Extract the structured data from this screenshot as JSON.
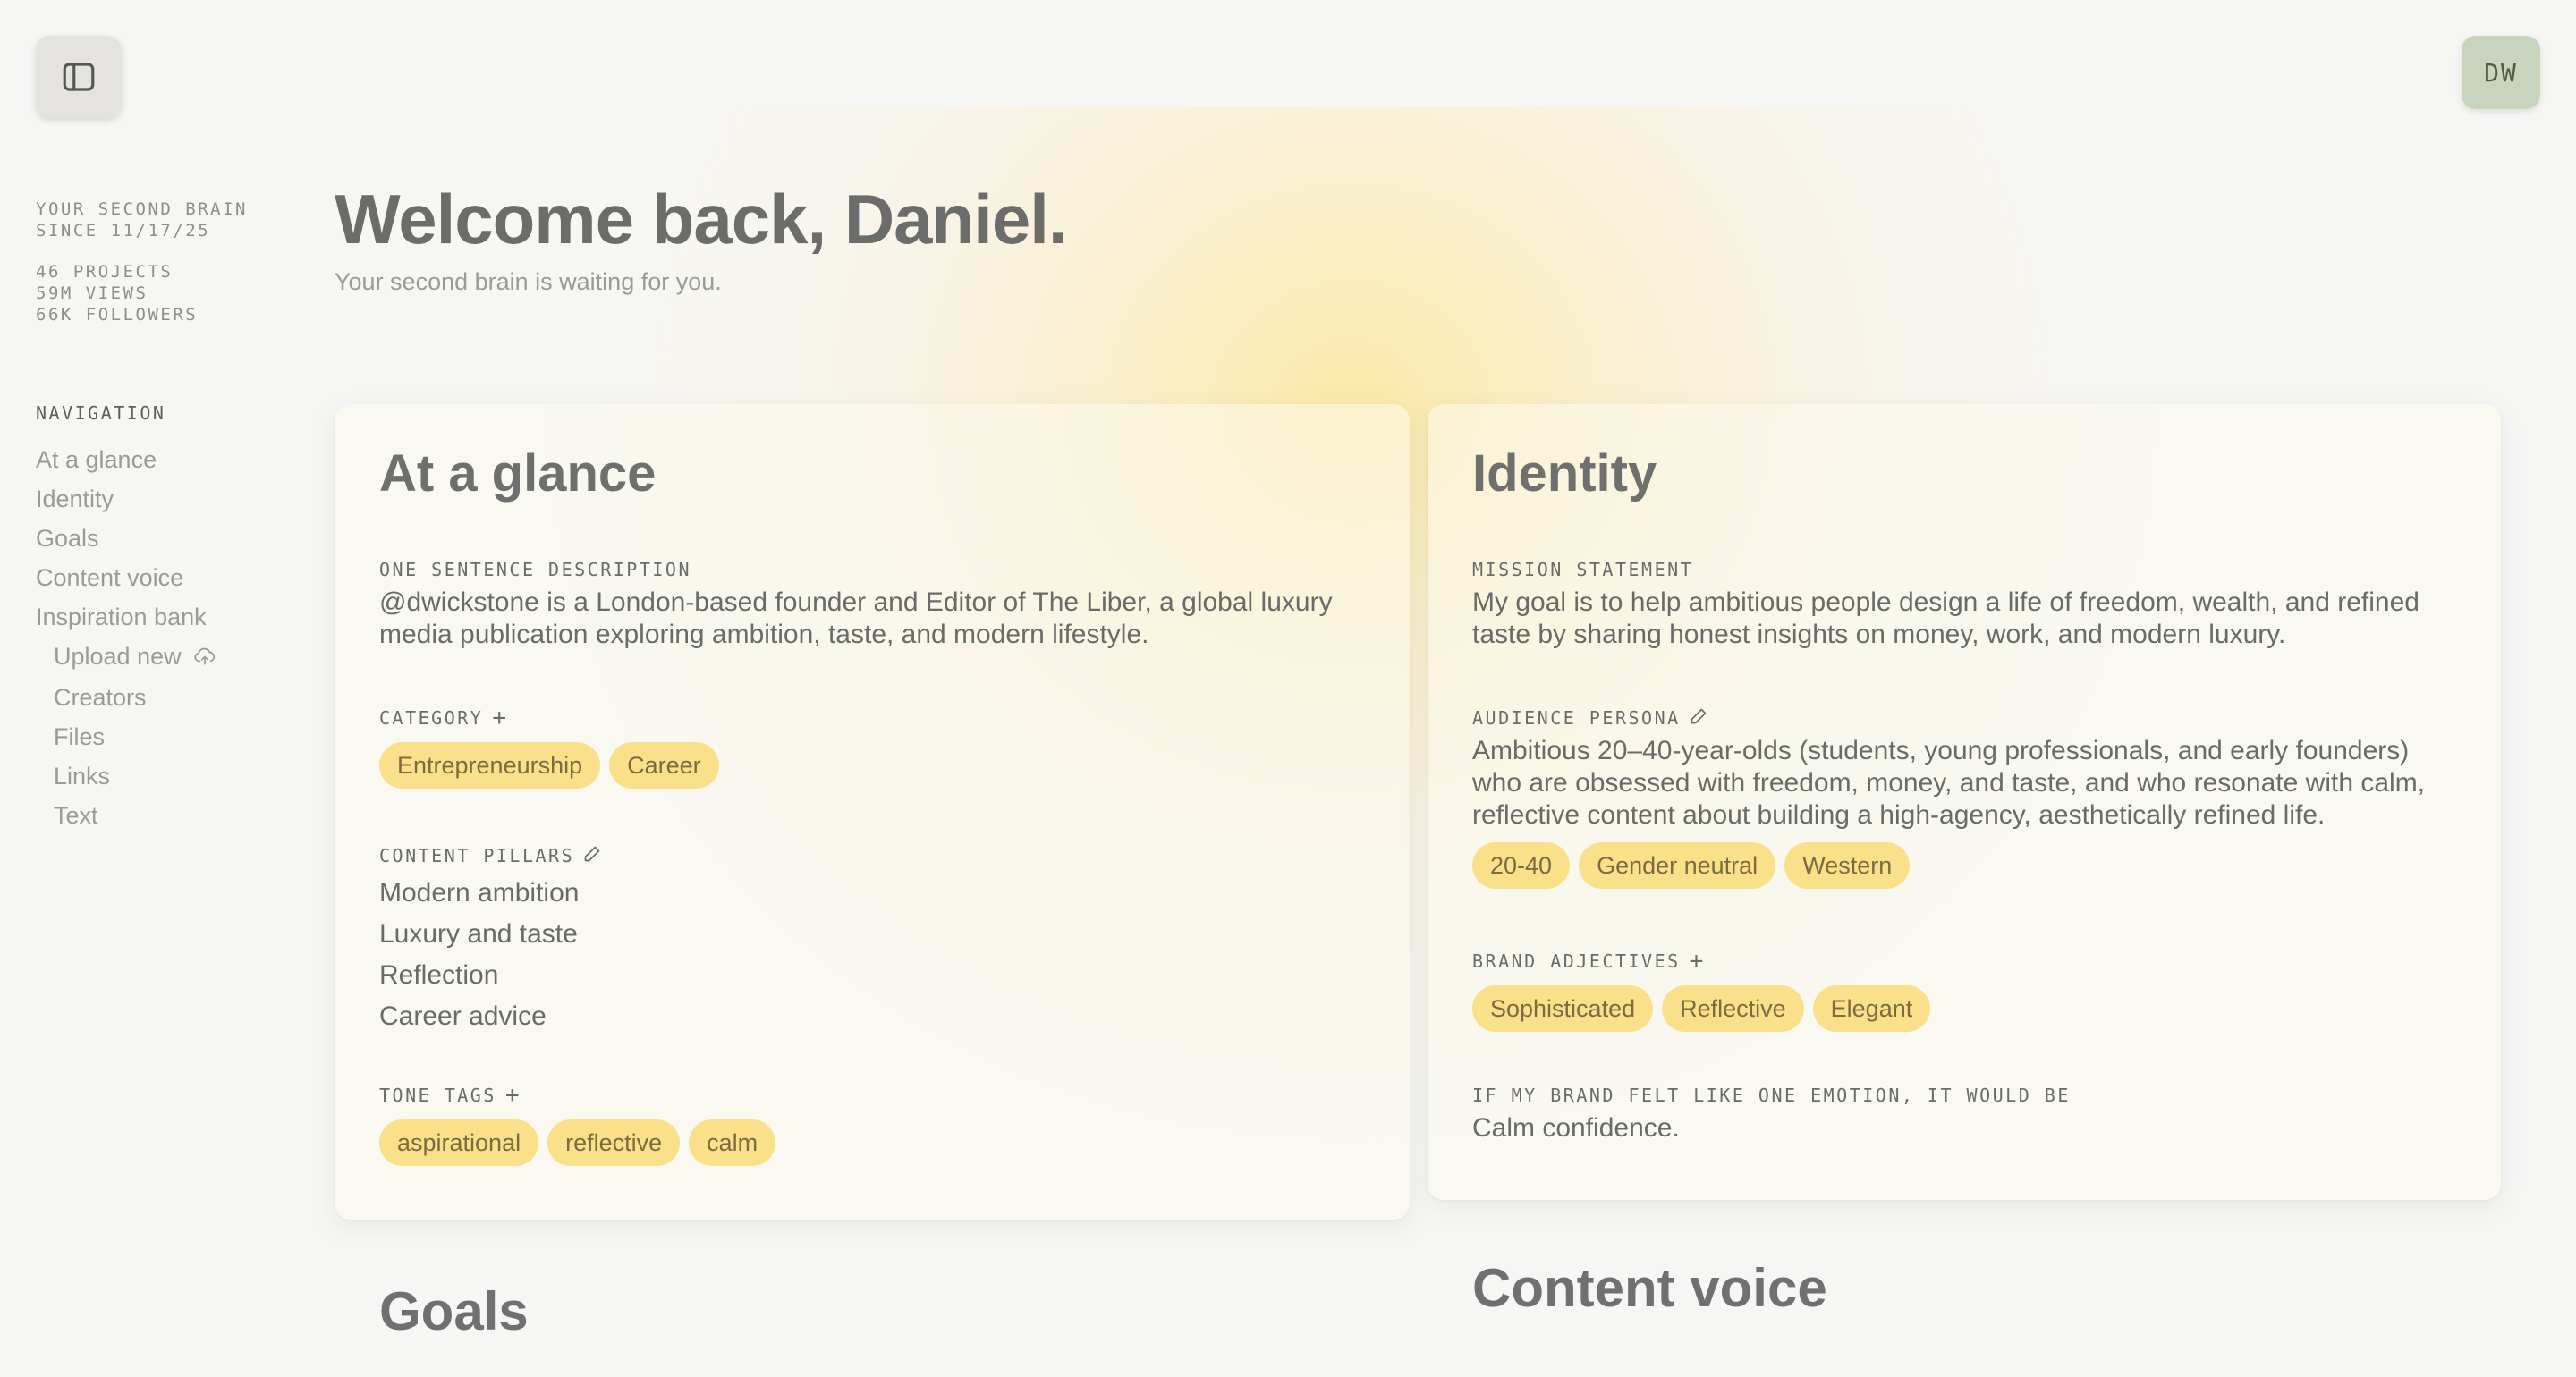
{
  "user": {
    "initials": "DW"
  },
  "sidebar": {
    "stats": {
      "tagline_line1": "YOUR SECOND BRAIN",
      "tagline_line2": "SINCE 11/17/25",
      "projects": "46 PROJECTS",
      "views": "59M VIEWS",
      "followers": "66K FOLLOWERS"
    },
    "nav_heading": "NAVIGATION",
    "nav": [
      {
        "label": "At a glance"
      },
      {
        "label": "Identity"
      },
      {
        "label": "Goals"
      },
      {
        "label": "Content voice"
      },
      {
        "label": "Inspiration bank"
      },
      {
        "label": "Upload new",
        "icon": "upload-cloud-icon"
      },
      {
        "label": "Creators"
      },
      {
        "label": "Files"
      },
      {
        "label": "Links"
      },
      {
        "label": "Text"
      }
    ]
  },
  "header": {
    "title": "Welcome back, Daniel.",
    "subtitle": "Your second brain is waiting for you."
  },
  "glance": {
    "title": "At a glance",
    "description_label": "ONE SENTENCE DESCRIPTION",
    "description": "@dwickstone is a London-based founder and Editor of The Liber, a global luxury media publication exploring ambition, taste, and modern lifestyle.",
    "category_label": "CATEGORY",
    "categories": [
      "Entrepreneurship",
      "Career"
    ],
    "pillars_label": "CONTENT PILLARS",
    "pillars": [
      "Modern ambition",
      "Luxury and taste",
      "Reflection",
      "Career advice"
    ],
    "tone_label": "TONE TAGS",
    "tones": [
      "aspirational",
      "reflective",
      "calm"
    ]
  },
  "identity": {
    "title": "Identity",
    "mission_label": "MISSION STATEMENT",
    "mission": "My goal is to help ambitious people design a life of freedom, wealth, and refined taste by sharing honest insights on money, work, and modern luxury.",
    "persona_label": "AUDIENCE PERSONA",
    "persona": "Ambitious 20–40-year-olds (students, young professionals, and early founders) who are obsessed with freedom, money, and taste, and who resonate with calm, reflective content about building a high-agency, aesthetically refined life.",
    "persona_tags": [
      "20-40",
      "Gender neutral",
      "Western"
    ],
    "adjectives_label": "BRAND ADJECTIVES",
    "adjectives": [
      "Sophisticated",
      "Reflective",
      "Elegant"
    ],
    "emotion_label": "IF MY BRAND FELT LIKE ONE EMOTION, IT WOULD BE",
    "emotion": "Calm confidence."
  },
  "sections": {
    "goals": "Goals",
    "content_voice": "Content voice"
  },
  "colors": {
    "background": "#f6f6f5",
    "tag": "#fbe08a",
    "avatar": "#c9d4bc",
    "glow": "#ffe178"
  }
}
